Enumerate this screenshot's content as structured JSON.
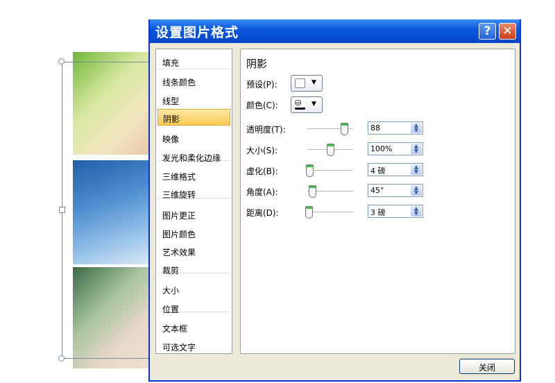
{
  "dialog": {
    "title": "设置图片格式",
    "help": "?",
    "close_glyph": "✕",
    "close_button": "关闭"
  },
  "nav": [
    "填充",
    "线条颜色",
    "线型",
    "阴影",
    "映像",
    "发光和柔化边缘",
    "三维格式",
    "三维旋转",
    "图片更正",
    "图片颜色",
    "艺术效果",
    "裁剪",
    "大小",
    "位置",
    "文本框",
    "可选文字"
  ],
  "selected": "阴影",
  "panel": {
    "heading": "阴影",
    "preset_label": "预设(P):",
    "color_label": "颜色(C):",
    "sliders": [
      {
        "label": "透明度(T):",
        "value": "88",
        "percent": 88
      },
      {
        "label": "大小(S):",
        "value": "100%",
        "percent": 55
      },
      {
        "label": "虚化(B):",
        "value": "4 磅",
        "percent": 5
      },
      {
        "label": "角度(A):",
        "value": "45°",
        "percent": 12
      },
      {
        "label": "距离(D):",
        "value": "3 磅",
        "percent": 3
      }
    ]
  }
}
